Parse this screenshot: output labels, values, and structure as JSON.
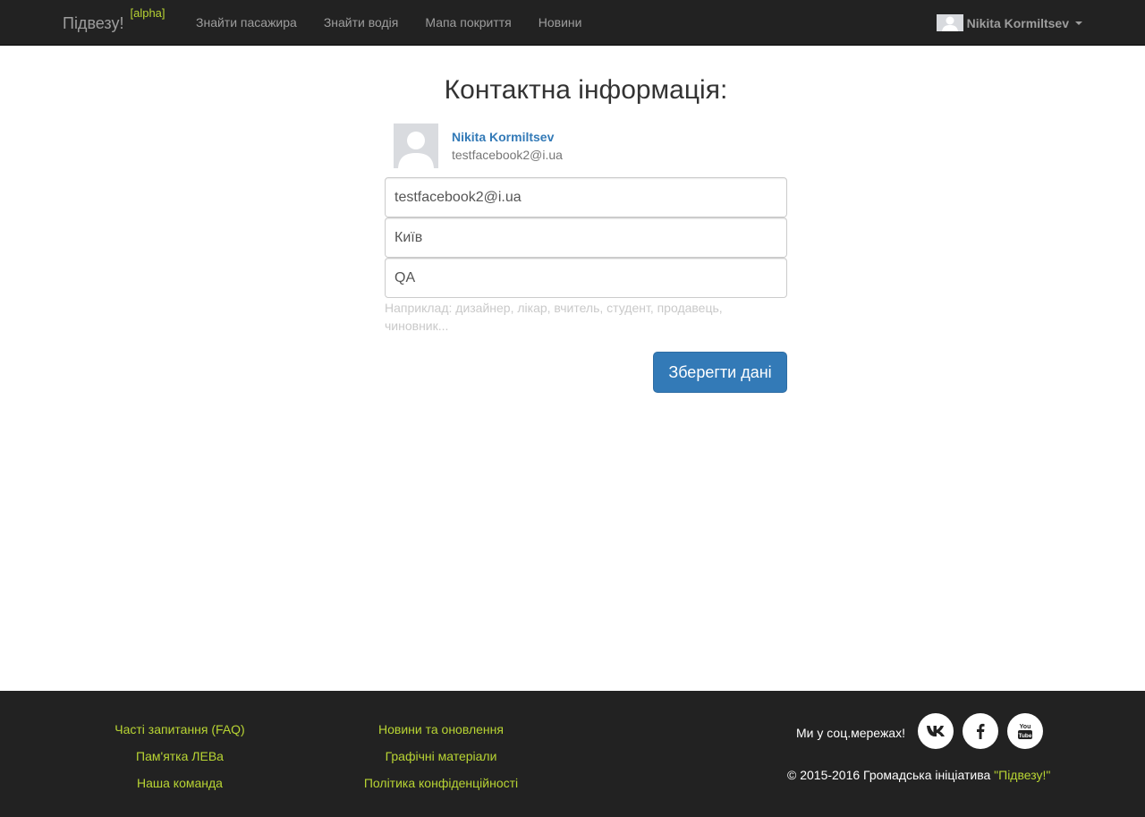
{
  "navbar": {
    "brand": "Підвезу!",
    "brand_badge": "[alpha]",
    "links": [
      "Знайти пасажира",
      "Знайти водія",
      "Мапа покриття",
      "Новини"
    ],
    "user_name": "Nikita Kormiltsev"
  },
  "main": {
    "title": "Контактна інформація:",
    "profile": {
      "name": "Nikita Kormiltsev",
      "email": "testfacebook2@i.ua"
    },
    "fields": {
      "email_value": "testfacebook2@i.ua",
      "city_value": "Київ",
      "job_value": "QA"
    },
    "help_text": "Наприклад: дизайнер, лікар, вчитель, студент, продавець, чиновник...",
    "save_label": "Зберегти дані"
  },
  "footer": {
    "col1": [
      "Часті запитання (FAQ)",
      "Пам'ятка ЛЕВа",
      "Наша команда"
    ],
    "col2": [
      "Новини та оновлення",
      "Графічні матеріали",
      "Політика конфіденційності"
    ],
    "social_label": "Ми у соц.мережах!",
    "social_icons": [
      "vk-icon",
      "facebook-icon",
      "youtube-icon"
    ],
    "copyright_prefix": "© 2015-2016 Громадська ініціатива",
    "copyright_link": "\"Підвезу!\""
  },
  "colors": {
    "navbar_bg": "#222222",
    "accent_green": "#b8d433",
    "primary_blue": "#337ab7"
  }
}
